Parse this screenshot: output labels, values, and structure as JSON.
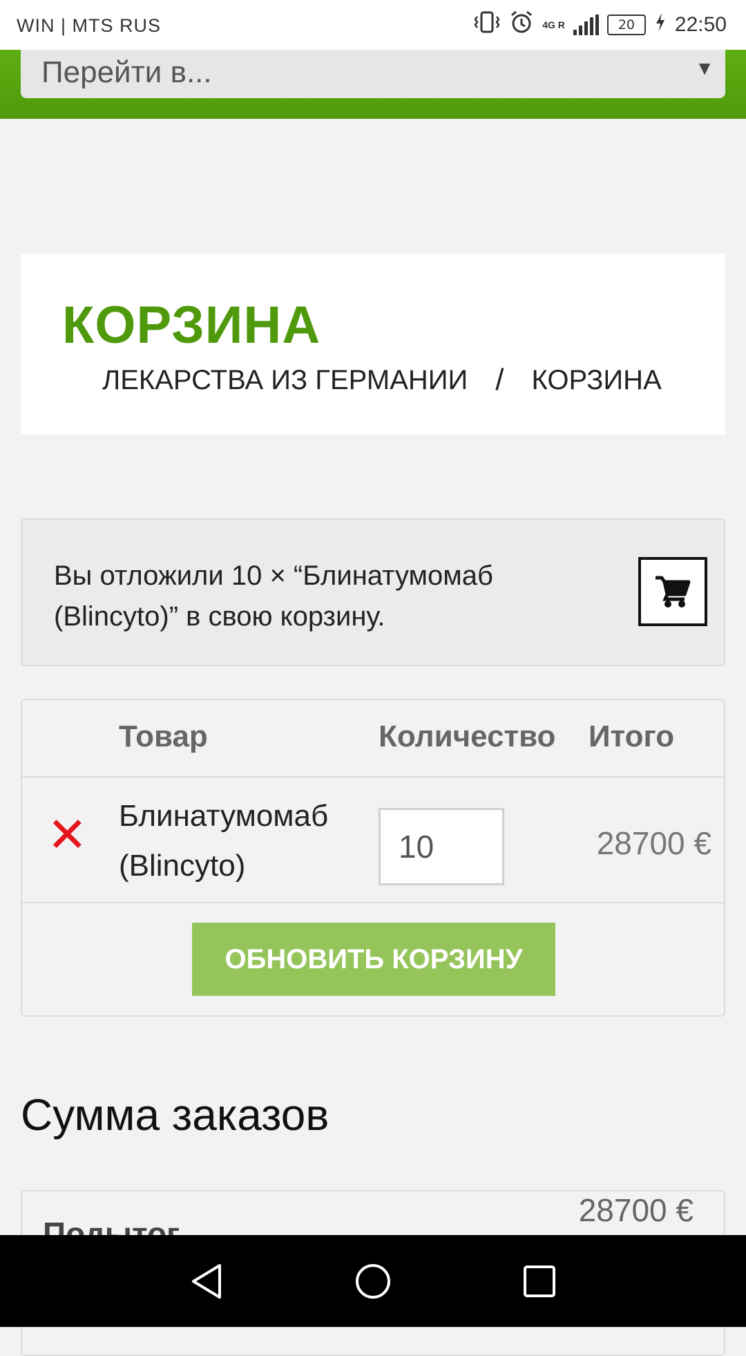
{
  "status_bar": {
    "carrier": "WIN | MTS RUS",
    "network": "4G R",
    "battery": "20",
    "time": "22:50",
    "icons": [
      "vibrate-icon",
      "alarm-icon",
      "signal-icon",
      "battery-icon",
      "charging-icon"
    ]
  },
  "nav": {
    "goto_placeholder": "Перейти в...",
    "dropdown_arrow": "▼"
  },
  "page": {
    "title": "КОРЗИНА",
    "breadcrumb": [
      "ЛЕКАРСТВА ИЗ ГЕРМАНИИ",
      "/",
      "КОРЗИНА"
    ]
  },
  "notice": {
    "line1": "Вы отложили 10 × “Блинатумомаб",
    "line2": "(Blincyto)” в свою корзину.",
    "icon": "cart-icon"
  },
  "cart": {
    "columns": [
      "Товар",
      "Количество",
      "Итого"
    ],
    "items": [
      {
        "remove": "✕",
        "name_line1": "Блинатумомаб",
        "name_line2": "(Blincyto)",
        "quantity": "10",
        "total": "28700 €"
      }
    ],
    "update_label": "ОБНОВИТЬ КОРЗИНУ"
  },
  "totals": {
    "heading": "Сумма заказов",
    "subtotal_label": "Подытог",
    "subtotal_value": "28700 €"
  },
  "colors": {
    "brand_green": "#4f9a0c",
    "button_green": "#95c45b",
    "remove_red": "#e4161c"
  },
  "system_nav": {
    "icons": [
      "back-icon",
      "home-icon",
      "recents-icon"
    ]
  }
}
